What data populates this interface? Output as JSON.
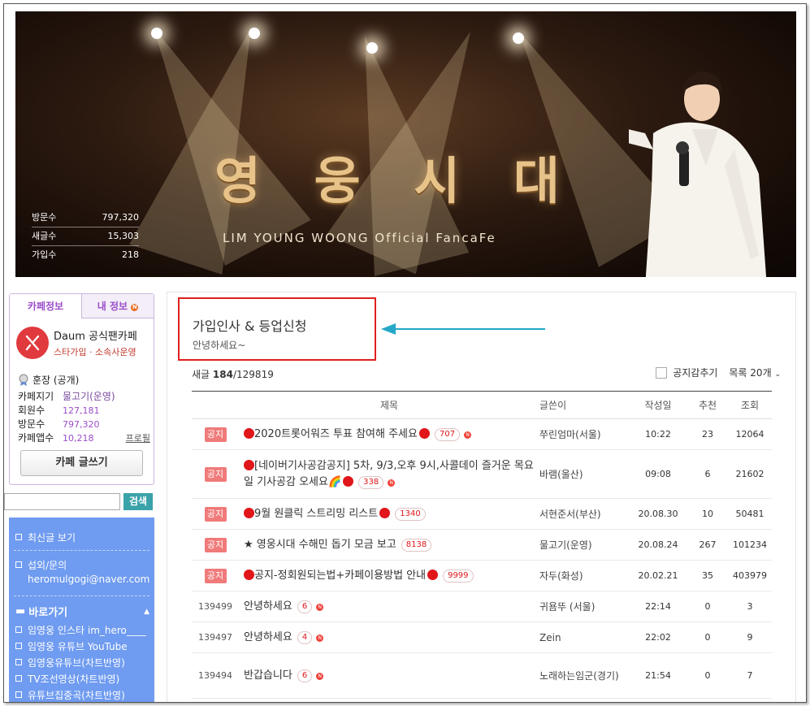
{
  "banner": {
    "title": "영 웅 시 대",
    "subtitle": "LIM YOUNG WOONG Official FancaFe",
    "stats": [
      {
        "label": "방문수",
        "value": "797,320"
      },
      {
        "label": "새글수",
        "value": "15,303"
      },
      {
        "label": "가입수",
        "value": "218"
      }
    ]
  },
  "sidebar": {
    "tabs": [
      {
        "label": "카페정보"
      },
      {
        "label": "내 정보"
      }
    ],
    "tab_badge": "N",
    "cafe_name": "Daum 공식팬카페",
    "cafe_sub": "스타가입 · 소속사운영",
    "rank": "훈장 (공개)",
    "info": [
      {
        "key": "카페지기",
        "value": "물고기(운영)"
      },
      {
        "key": "회원수",
        "value": "127,181"
      },
      {
        "key": "방문수",
        "value": "797,320"
      },
      {
        "key": "카페앱수",
        "value": "10,218",
        "link": "프로필"
      }
    ],
    "write_button": "카페 글쓰기",
    "search_button": "검색",
    "menu": {
      "recent": "최신글 보기",
      "contact": "섭외/문의",
      "contact_email": "heromulgogi@naver.com",
      "shortcut_header": "바로가기",
      "links": [
        "임영웅 인스타 im_hero____",
        "임영웅 유튜브 YouTube",
        "임영웅유튜브(차트반영)",
        "TV조선영상(차트반영)",
        "유튜브집중곡(차트반영)"
      ]
    }
  },
  "board": {
    "title": "가입인사 & 등업신청",
    "desc": "안녕하세요~",
    "count_label": "새글",
    "count_new": "184",
    "count_total": "/129819",
    "hide_notice": "공지감추기",
    "list_option": "목록 20개",
    "columns": [
      "제목",
      "글쓴이",
      "작성일",
      "추천",
      "조회"
    ],
    "notice_label": "공지",
    "rows": [
      {
        "num": "",
        "notice": true,
        "pre_dot": true,
        "title": "2020트롯어워즈 투표 참여해 주세요",
        "post_dot": true,
        "comments": "707",
        "new": "N",
        "author": "쭈린엄마(서울)",
        "date": "10:22",
        "rec": "23",
        "views": "12064"
      },
      {
        "num": "",
        "notice": true,
        "pre_dot": true,
        "title": "[네이버기사공감공지] 5차, 9/3,오후 9시,사콜데이 즐거운 목요일 기사공감 오세요🌈",
        "post_dot": true,
        "comments": "338",
        "new": "N",
        "author": "바램(울산)",
        "date": "09:08",
        "rec": "6",
        "views": "21602"
      },
      {
        "num": "",
        "notice": true,
        "pre_dot": true,
        "title": "9월 원클릭 스트리밍 리스트",
        "post_dot": true,
        "comments": "1340",
        "new": "",
        "author": "서현준서(부산)",
        "date": "20.08.30",
        "rec": "10",
        "views": "50481"
      },
      {
        "num": "",
        "notice": true,
        "pre_dot": false,
        "title": "★ 영웅시대 수해민 돕기 모금 보고",
        "post_dot": false,
        "comments": "8138",
        "new": "",
        "author": "물고기(운영)",
        "date": "20.08.24",
        "rec": "267",
        "views": "101234"
      },
      {
        "num": "",
        "notice": true,
        "pre_dot": true,
        "title": "공지-정회원되는법+카페이용방법 안내",
        "post_dot": true,
        "comments": "9999",
        "new": "",
        "author": "자두(화성)",
        "date": "20.02.21",
        "rec": "35",
        "views": "403979"
      },
      {
        "num": "139499",
        "notice": false,
        "pre_dot": false,
        "title": "안녕하세요",
        "post_dot": false,
        "comments": "6",
        "new": "N",
        "author": "귀욤뚜 (서울)",
        "date": "22:14",
        "rec": "0",
        "views": "3"
      },
      {
        "num": "139497",
        "notice": false,
        "pre_dot": false,
        "title": "안녕하세요",
        "post_dot": false,
        "comments": "4",
        "new": "N",
        "author": "Zein",
        "date": "22:02",
        "rec": "0",
        "views": "9"
      },
      {
        "num": "139494",
        "notice": false,
        "pre_dot": false,
        "title": "반갑습니다",
        "post_dot": false,
        "comments": "6",
        "new": "N",
        "author": "노래하는임군(경기)",
        "date": "21:54",
        "rec": "0",
        "views": "7"
      }
    ]
  },
  "colors": {
    "accent_purple": "#9b4dca",
    "highlight_red": "#e01f1f",
    "arrow_teal": "#25a8c8",
    "menu_blue": "#6f9bf0"
  }
}
